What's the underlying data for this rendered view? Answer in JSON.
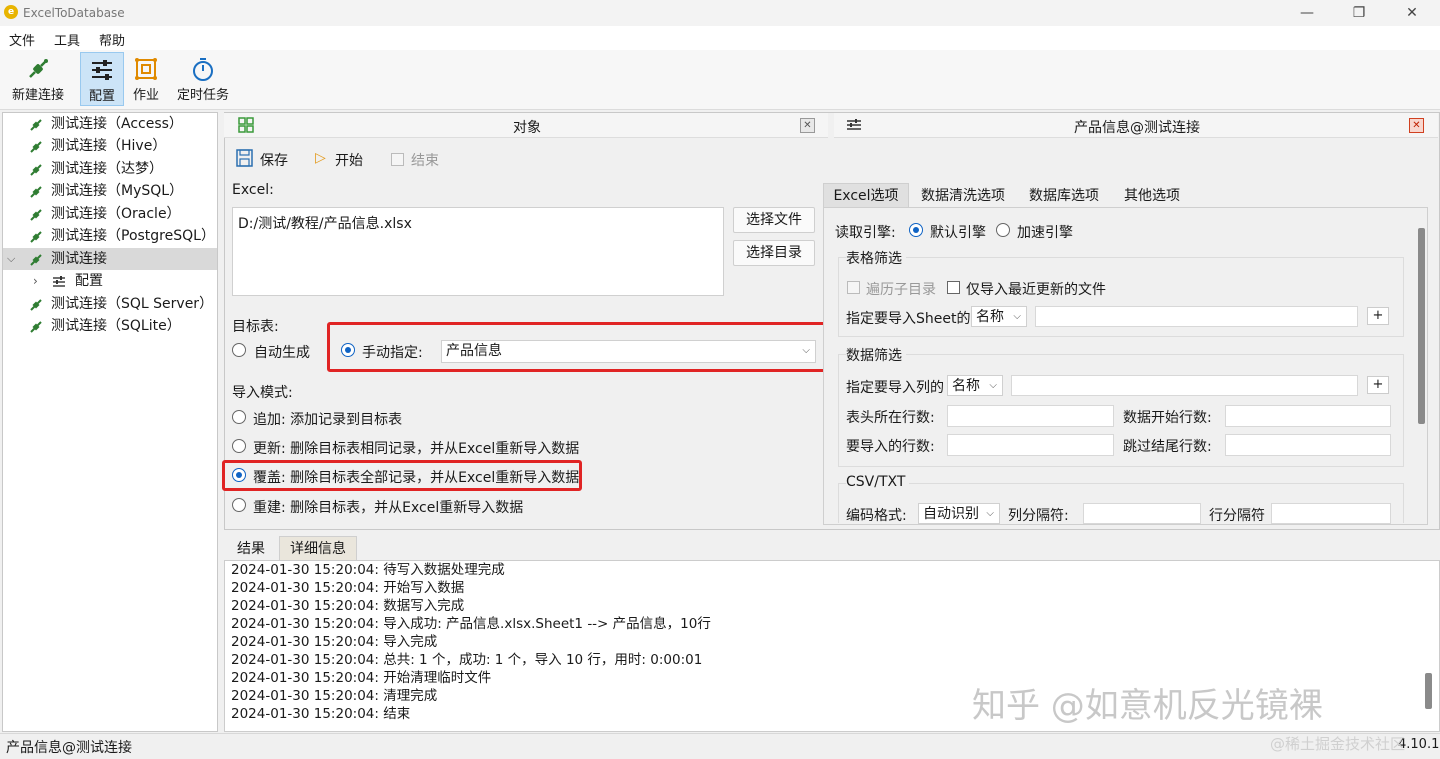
{
  "window": {
    "title": "ExcelToDatabase"
  },
  "menu": [
    "文件",
    "工具",
    "帮助"
  ],
  "toolbar": {
    "new_connection": "新建连接",
    "config": "配置",
    "job": "作业",
    "scheduled": "定时任务"
  },
  "tree": {
    "items": [
      "测试连接（Access）",
      "测试连接（Hive）",
      "测试连接（达梦）",
      "测试连接（MySQL）",
      "测试连接（Oracle）",
      "测试连接（PostgreSQL）",
      "测试连接",
      "配置",
      "测试连接（SQL Server）",
      "测试连接（SQLite）"
    ]
  },
  "object_panel": {
    "title": "对象",
    "save": "保存",
    "start": "开始",
    "end": "结束",
    "excel_label": "Excel:",
    "excel_path": "D:/测试/教程/产品信息.xlsx",
    "choose_file": "选择文件",
    "choose_dir": "选择目录",
    "target_label": "目标表:",
    "auto_gen": "自动生成",
    "manual": "手动指定:",
    "target_table": "产品信息",
    "import_mode_label": "导入模式:",
    "mode_append": "追加: 添加记录到目标表",
    "mode_update": "更新: 删除目标表相同记录，并从Excel重新导入数据",
    "mode_overwrite": "覆盖: 删除目标表全部记录，并从Excel重新导入数据",
    "mode_rebuild": "重建: 删除目标表，并从Excel重新导入数据"
  },
  "product_panel": {
    "title": "产品信息@测试连接",
    "tabs": [
      "Excel选项",
      "数据清洗选项",
      "数据库选项",
      "其他选项"
    ],
    "read_engine": "读取引擎:",
    "engine_default": "默认引擎",
    "engine_fast": "加速引擎",
    "table_filter": "表格筛选",
    "traverse_subdir": "遍历子目录",
    "only_latest": "仅导入最近更新的文件",
    "sheet_spec": "指定要导入Sheet的",
    "name_opt": "名称",
    "data_filter": "数据筛选",
    "col_spec": "指定要导入列的",
    "plus": "+",
    "header_row": "表头所在行数:",
    "data_start_row": "数据开始行数:",
    "rows_to_import": "要导入的行数:",
    "skip_end_rows": "跳过结尾行数:",
    "csv": "CSV/TXT",
    "encoding": "编码格式:",
    "encoding_value": "自动识别",
    "col_sep": "列分隔符:",
    "row_sep": "行分隔符"
  },
  "bottom": {
    "tabs": [
      "结果",
      "详细信息"
    ],
    "log": [
      "2024-01-30 15:20:04: 待写入数据处理完成",
      "2024-01-30 15:20:04: 开始写入数据",
      "2024-01-30 15:20:04: 数据写入完成",
      "2024-01-30 15:20:04: 导入成功: 产品信息.xlsx.Sheet1 --> 产品信息，10行",
      "2024-01-30 15:20:04: 导入完成",
      "2024-01-30 15:20:04: 总共: 1 个，成功: 1 个，导入 10 行，用时: 0:00:01",
      "2024-01-30 15:20:04: 开始清理临时文件",
      "2024-01-30 15:20:04: 清理完成",
      "2024-01-30 15:20:04: 结束"
    ]
  },
  "status": {
    "left": "产品信息@测试连接",
    "version": "4.10.1"
  },
  "watermarks": {
    "zhihu": "知乎 @如意机反光镜裸",
    "juejin": "@稀土掘金技术社区"
  },
  "colors": {
    "accent": "#0f63c4",
    "highlight": "#e02424",
    "plug": "#2f7d32"
  }
}
